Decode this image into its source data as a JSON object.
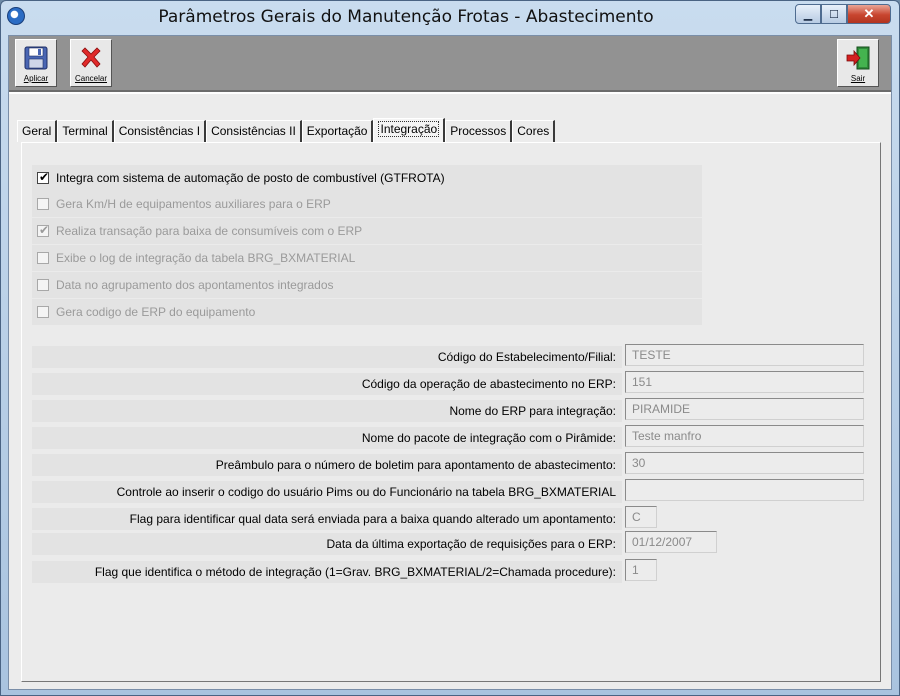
{
  "window": {
    "title": "Parâmetros Gerais do Manutenção Frotas - Abastecimento"
  },
  "toolbar": {
    "apply_label": "Aplicar",
    "cancel_label": "Cancelar",
    "exit_label": "Sair"
  },
  "tabs": [
    {
      "label": "Geral"
    },
    {
      "label": "Terminal"
    },
    {
      "label": "Consistências I"
    },
    {
      "label": "Consistências II"
    },
    {
      "label": "Exportação"
    },
    {
      "label": "Integração"
    },
    {
      "label": "Processos"
    },
    {
      "label": "Cores"
    }
  ],
  "active_tab": "Integração",
  "checkboxes": [
    {
      "label": "Integra com sistema de automação de posto de combustível (GTFROTA)",
      "checked": true,
      "enabled": true
    },
    {
      "label": "Gera Km/H de equipamentos auxiliares  para o ERP",
      "checked": false,
      "enabled": false
    },
    {
      "label": "Realiza transação para baixa de consumíveis com o ERP",
      "checked": true,
      "enabled": false
    },
    {
      "label": "Exibe o log de integração da tabela BRG_BXMATERIAL",
      "checked": false,
      "enabled": false
    },
    {
      "label": "Data no agrupamento dos apontamentos integrados",
      "checked": false,
      "enabled": false
    },
    {
      "label": "Gera codigo de ERP do equipamento",
      "checked": false,
      "enabled": false
    }
  ],
  "fields": [
    {
      "label": "Código do Estabelecimento/Filial:",
      "value": "TESTE"
    },
    {
      "label": "Código da operação de abastecimento no ERP:",
      "value": "151"
    },
    {
      "label": "Nome do ERP para integração:",
      "value": "PIRAMIDE"
    },
    {
      "label": "Nome do pacote de integração com o Pirâmide:",
      "value": "Teste manfro"
    },
    {
      "label": "Preâmbulo para o número de boletim para apontamento de abastecimento:",
      "value": "30"
    },
    {
      "label": "Controle ao inserir o codigo do usuário Pims ou do Funcionário na tabela BRG_BXMATERIAL",
      "value": ""
    },
    {
      "label": "Flag para identificar qual data será enviada para a baixa quando alterado um apontamento:",
      "value": "C"
    },
    {
      "label": "Data da última exportação de requisições para o ERP:",
      "value": "01/12/2007"
    },
    {
      "label": "Flag que identifica o método de integração (1=Grav. BRG_BXMATERIAL/2=Chamada procedure):",
      "value": "1"
    }
  ]
}
